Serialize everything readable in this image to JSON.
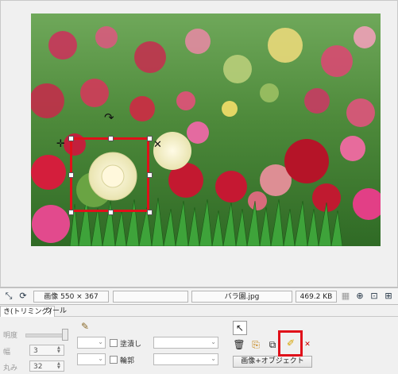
{
  "status": {
    "image_info": "画像 550 × 367",
    "filename": "バラ園.jpg",
    "filesize": "469.2 KB"
  },
  "tabs": [
    {
      "label": "き(トリミング)",
      "active": true
    },
    {
      "label": "ツール",
      "active": false
    }
  ],
  "panel": {
    "opacity_label": "明度",
    "width_label": "幅",
    "width_value": "3",
    "round_label": "丸み",
    "round_value": "32",
    "fill_label": "塗潰し",
    "outline_label": "輪郭",
    "image_object_button": "画像+オブジェクト"
  },
  "icons": {
    "rotate": "rotate-icon",
    "close": "close-x-icon",
    "move": "move-cross-icon",
    "pen": "pen-icon",
    "pointer": "pointer-arrow-icon",
    "eraser_tool": "eraser-tool-icon"
  },
  "colors": {
    "selection": "#e0101a",
    "highlight": "#e0101a"
  }
}
